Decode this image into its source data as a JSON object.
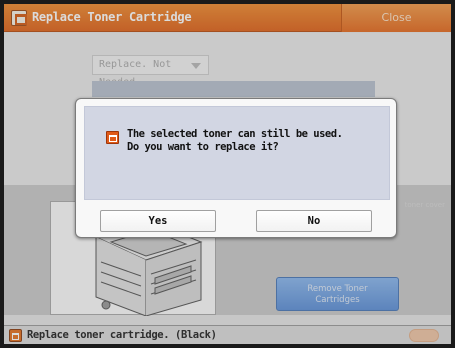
{
  "window": {
    "title": "Replace Toner Cartridge",
    "close_label": "Close"
  },
  "background": {
    "replace_dropdown": "Replace. Not Needed",
    "remove_button": [
      "Remove Toner",
      "Cartridges"
    ],
    "side_hint": "toner cover"
  },
  "dialog": {
    "message_line1": "The selected toner can still be used.",
    "message_line2": "Do you want to replace it?",
    "yes_label": "Yes",
    "no_label": "No"
  },
  "status": {
    "text": "Replace toner cartridge. (Black)"
  },
  "icons": {
    "title": "toner-icon",
    "dialog": "warning-icon",
    "status": "toner-icon"
  },
  "colors": {
    "title_bar": "#e8762a",
    "dialog_panel": "#d2d6e3",
    "accent_blue": "#5d90d8"
  }
}
